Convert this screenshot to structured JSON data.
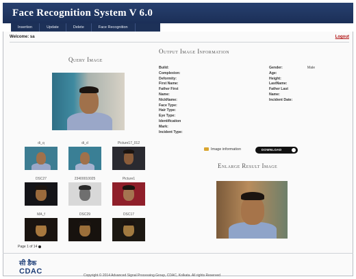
{
  "app": {
    "title": "Face Recognition System V 6.0"
  },
  "nav": {
    "items": [
      "Insertion",
      "Update",
      "Delete",
      "Face Recognition"
    ]
  },
  "user": {
    "welcome": "Welcome: sa",
    "logout": "Logout"
  },
  "query": {
    "title": "Query Image"
  },
  "output": {
    "title": "Output Image Information",
    "left_fields": [
      "Build:",
      "Complexion:",
      "Deformity:",
      "First Name:",
      "Father First",
      "Name:",
      "NickName:",
      "Face Type:",
      "Hair Type:",
      "Eye Type:",
      "Identification",
      "Mark:",
      "Incident Type:"
    ],
    "right_fields": [
      "Gender:",
      "Age:",
      "Height:",
      "LastName:",
      "Father Last",
      "Name:",
      "Incident Date:"
    ],
    "gender_value": "Male"
  },
  "actions": {
    "image_info": "Image information",
    "download": "DOWNLOAD"
  },
  "enlarge": {
    "title": "Enlarge Result Image"
  },
  "gallery": {
    "items": [
      {
        "label": "di_q"
      },
      {
        "label": "di_d"
      },
      {
        "label": "Picture17_012"
      },
      {
        "label": "DSC27"
      },
      {
        "label": "23400010025"
      },
      {
        "label": "Picture1"
      },
      {
        "label": "MA_f"
      },
      {
        "label": "DSC29"
      },
      {
        "label": "DSC17"
      }
    ],
    "pager": "Page 1 of 14"
  },
  "footer": {
    "logo_hindi": "सी डैक",
    "logo_text": "CDAC",
    "copyright": "Copyright © 2014 Advanced Signal Processing Group, CDAC, Kolkata. All rights Reserved"
  }
}
